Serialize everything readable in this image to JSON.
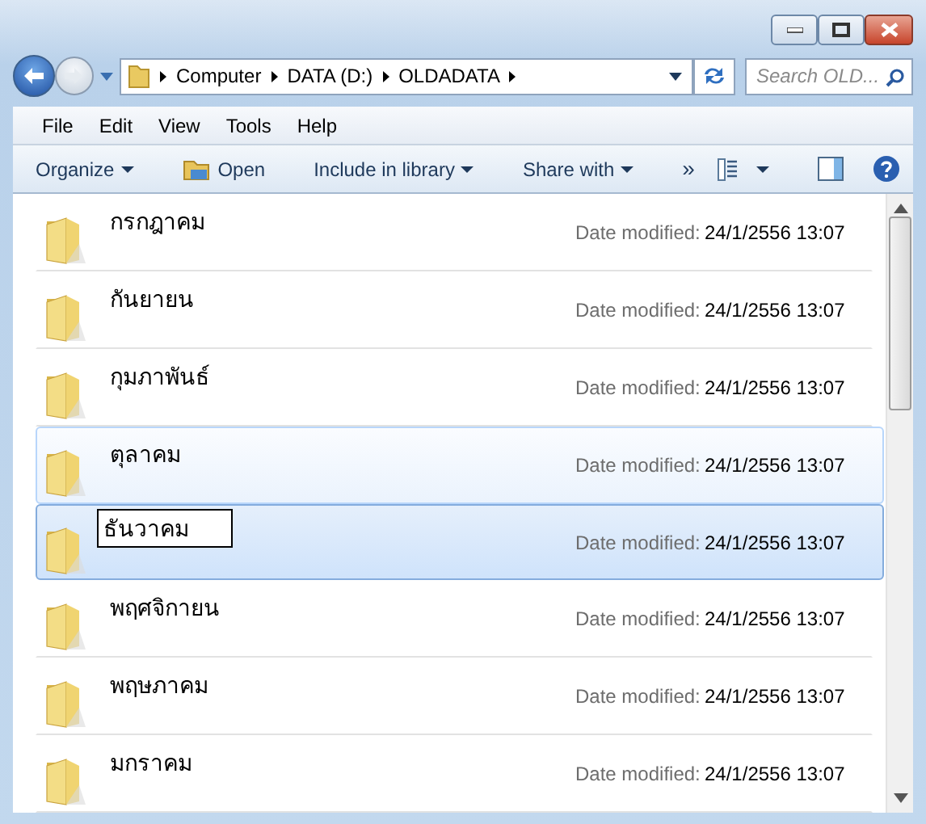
{
  "address": {
    "breadcrumbs": [
      "Computer",
      "DATA (D:)",
      "OLDADATA"
    ]
  },
  "search": {
    "placeholder": "Search OLD..."
  },
  "menu": [
    "File",
    "Edit",
    "View",
    "Tools",
    "Help"
  ],
  "toolbar": [
    {
      "label": "Organize",
      "kind": "dropdown"
    },
    {
      "label": "Open",
      "kind": "open"
    },
    {
      "label": "Include in library",
      "kind": "dropdown"
    },
    {
      "label": "Share with",
      "kind": "dropdown"
    },
    {
      "label": "»",
      "kind": "overflow"
    }
  ],
  "files": [
    {
      "name": "กรกฎาคม",
      "date_label": "Date modified:",
      "date": "24/1/2556 13:07",
      "selected": false,
      "hovered": false,
      "editing": false
    },
    {
      "name": "กันยายน",
      "date_label": "Date modified:",
      "date": "24/1/2556 13:07",
      "selected": false,
      "hovered": false,
      "editing": false
    },
    {
      "name": "กุมภาพันธ์",
      "date_label": "Date modified:",
      "date": "24/1/2556 13:07",
      "selected": false,
      "hovered": false,
      "editing": false
    },
    {
      "name": "ตุลาคม",
      "date_label": "Date modified:",
      "date": "24/1/2556 13:07",
      "selected": false,
      "hovered": true,
      "editing": false
    },
    {
      "name": "ธันวาคม",
      "date_label": "Date modified:",
      "date": "24/1/2556 13:07",
      "selected": true,
      "hovered": false,
      "editing": true
    },
    {
      "name": "พฤศจิกายน",
      "date_label": "Date modified:",
      "date": "24/1/2556 13:07",
      "selected": false,
      "hovered": false,
      "editing": false
    },
    {
      "name": "พฤษภาคม",
      "date_label": "Date modified:",
      "date": "24/1/2556 13:07",
      "selected": false,
      "hovered": false,
      "editing": false
    },
    {
      "name": "มกราคม",
      "date_label": "Date modified:",
      "date": "24/1/2556 13:07",
      "selected": false,
      "hovered": false,
      "editing": false
    }
  ]
}
